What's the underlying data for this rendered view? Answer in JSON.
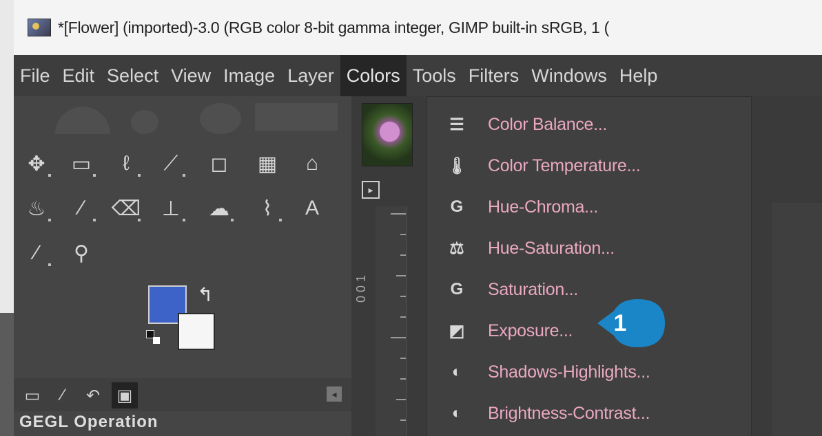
{
  "title_bar": {
    "icon": "gimp-app-icon",
    "title": "*[Flower] (imported)-3.0 (RGB color 8-bit gamma integer, GIMP built-in sRGB, 1 ("
  },
  "menubar": {
    "items": [
      {
        "label": "File"
      },
      {
        "label": "Edit"
      },
      {
        "label": "Select"
      },
      {
        "label": "View"
      },
      {
        "label": "Image"
      },
      {
        "label": "Layer"
      },
      {
        "label": "Colors",
        "active": true
      },
      {
        "label": "Tools"
      },
      {
        "label": "Filters"
      },
      {
        "label": "Windows"
      },
      {
        "label": "Help"
      }
    ]
  },
  "toolbox": {
    "tools": [
      {
        "icon": "move-tool-icon"
      },
      {
        "icon": "rect-select-icon"
      },
      {
        "icon": "free-select-icon"
      },
      {
        "icon": "fuzzy-select-icon"
      },
      {
        "icon": "crop-tool-icon"
      },
      {
        "icon": "unified-transform-icon"
      },
      {
        "icon": "warp-transform-icon"
      },
      {
        "icon": "bucket-fill-icon"
      },
      {
        "icon": "paintbrush-icon"
      },
      {
        "icon": "eraser-icon"
      },
      {
        "icon": "clone-tool-icon"
      },
      {
        "icon": "smudge-tool-icon"
      },
      {
        "icon": "paths-tool-icon"
      },
      {
        "icon": "text-tool-icon",
        "glyph": "A"
      },
      {
        "icon": "color-picker-icon"
      },
      {
        "icon": "zoom-tool-icon"
      }
    ],
    "foreground_color": "#3d63c8",
    "background_color": "#f6f6f6",
    "dock_tabs": [
      {
        "icon": "device-status-icon"
      },
      {
        "icon": "tool-options-icon"
      },
      {
        "icon": "undo-history-icon"
      },
      {
        "icon": "images-icon"
      }
    ],
    "tool_options_label": "GEGL Operation"
  },
  "colors_menu": {
    "items": [
      {
        "label": "Color Balance...",
        "icon": "color-balance-icon",
        "glyph": "☰"
      },
      {
        "label": "Color Temperature...",
        "icon": "color-temperature-icon",
        "glyph": "🌡"
      },
      {
        "label": "Hue-Chroma...",
        "icon": "hue-chroma-icon",
        "glyph": "G"
      },
      {
        "label": "Hue-Saturation...",
        "icon": "hue-saturation-icon",
        "glyph": "⚖"
      },
      {
        "label": "Saturation...",
        "icon": "saturation-icon",
        "glyph": "G"
      },
      {
        "label": "Exposure...",
        "icon": "exposure-icon",
        "glyph": "◩"
      },
      {
        "label": "Shadows-Highlights...",
        "icon": "shadows-highlights-icon",
        "glyph": "◐"
      },
      {
        "label": "Brightness-Contrast...",
        "icon": "brightness-contrast-icon",
        "glyph": "◐"
      }
    ]
  },
  "callout": {
    "number": "1",
    "color": "#1a86c7"
  },
  "ruler": {
    "label": "0 0 1"
  }
}
